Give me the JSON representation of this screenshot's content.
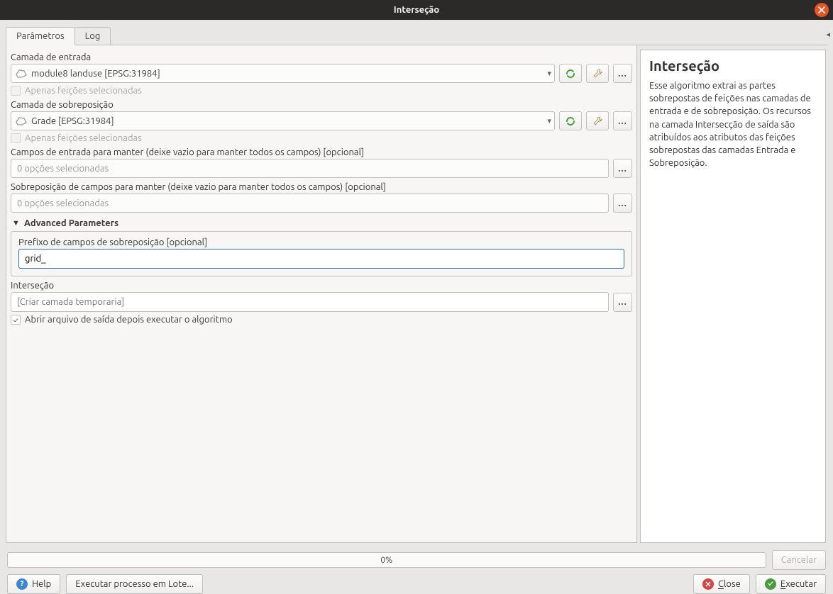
{
  "window": {
    "title": "Interseção"
  },
  "tabs": {
    "params": "Parâmetros",
    "log": "Log"
  },
  "input_layer": {
    "label": "Camada de entrada",
    "value": "module8 landuse [EPSG:31984]"
  },
  "overlay_layer": {
    "label": "Camada de sobreposição",
    "value": "Grade [EPSG:31984]"
  },
  "selected_only_label": "Apenas feições selecionadas",
  "input_fields": {
    "label": "Campos de entrada para manter (deixe vazio para manter todos os campos) [opcional]",
    "placeholder": "0 opções selecionadas"
  },
  "overlay_fields": {
    "label": "Sobreposição de campos para manter (deixe vazio para manter todos os campos) [opcional]",
    "placeholder": "0 opções selecionadas"
  },
  "advanced": {
    "title": "Advanced Parameters",
    "overlay_prefix_label": "Prefixo de campos de sobreposição [opcional]",
    "overlay_prefix_value": "grid_"
  },
  "output": {
    "label": "Interseção",
    "placeholder": "[Criar camada temporaria]"
  },
  "open_after_label": "Abrir arquivo de saída depois executar o algoritmo",
  "help": {
    "title": "Interseção",
    "body": "Esse algoritmo extrai as partes sobrepostas de feições nas camadas de entrada e de sobreposição. Os recursos na camada Intersecção de saída são atribuídos aos atributos das feições sobrepostas das camadas Entrada e Sobreposição."
  },
  "progress_text": "0%",
  "buttons": {
    "cancel": "Cancelar",
    "help": "Help",
    "batch": "Executar processo em Lote...",
    "close": "Close",
    "close_u": "C",
    "run": "Executar",
    "run_u": "E"
  }
}
